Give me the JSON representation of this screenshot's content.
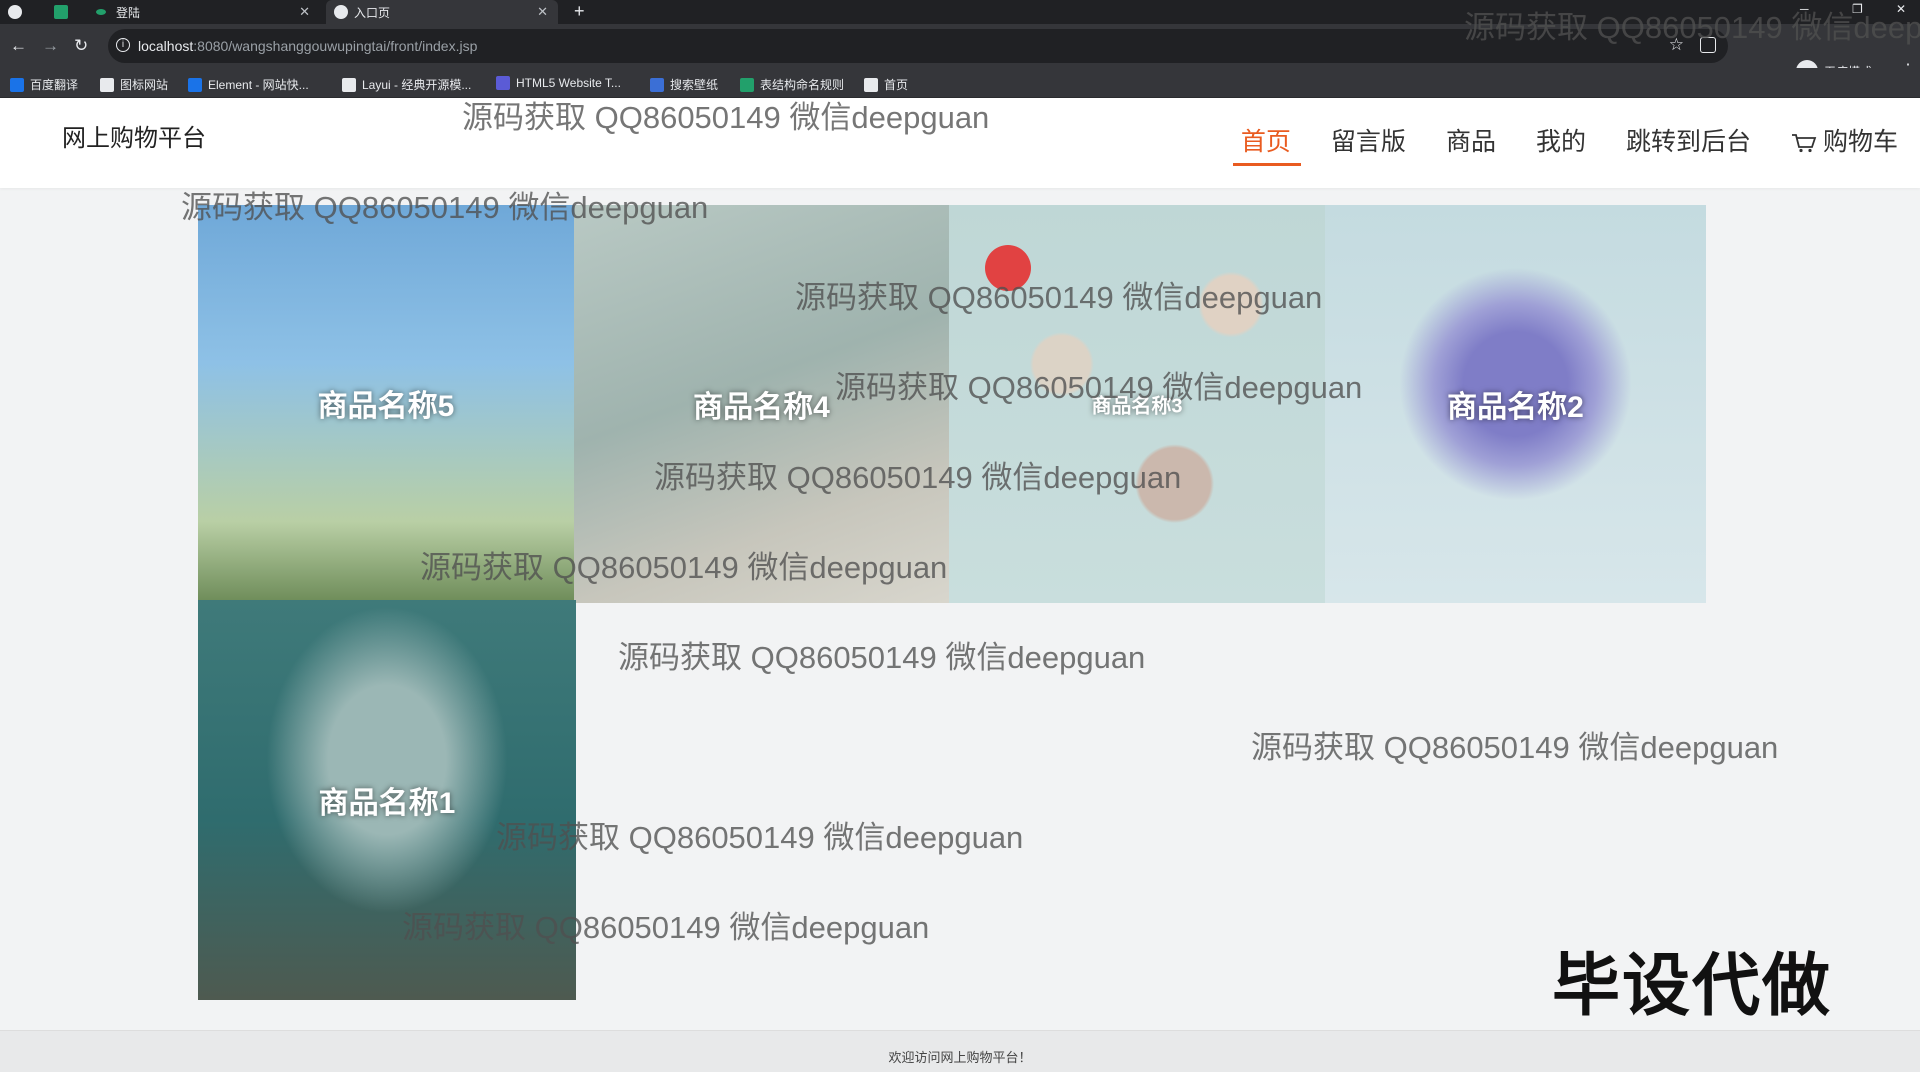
{
  "browser": {
    "tabs": [
      {
        "title": ""
      },
      {
        "title": "登陆"
      },
      {
        "title": "入口页"
      }
    ],
    "url_host": "localhost",
    "url_rest": ":8080/wangshanggouwupingtai/front/index.jsp",
    "incognito_label": "无痕模式",
    "bookmarks": [
      "百度翻译",
      "图标网站",
      "Element - 网站快...",
      "Layui - 经典开源模...",
      "HTML5 Website T...",
      "搜索壁纸",
      "表结构命名规则",
      "首页"
    ],
    "bookmark_colors": [
      "#1a73e8",
      "#e8eaed",
      "#1a73e8",
      "#e8eaed",
      "#5b5bd6",
      "#3b6fd6",
      "#22a06b",
      "#e8eaed"
    ]
  },
  "site": {
    "logo": "网上购物平台",
    "nav": [
      "首页",
      "留言版",
      "商品",
      "我的",
      "跳转到后台",
      "购物车"
    ],
    "accent_color": "#e95b20"
  },
  "products": [
    {
      "name": "商品名称5"
    },
    {
      "name": "商品名称4"
    },
    {
      "name": "商品名称3"
    },
    {
      "name": "商品名称2"
    },
    {
      "name": "商品名称1"
    }
  ],
  "watermark": "源码获取 QQ86050149 微信deepguan",
  "stamp": "毕设代做",
  "footer": "欢迎访问网上购物平台！"
}
